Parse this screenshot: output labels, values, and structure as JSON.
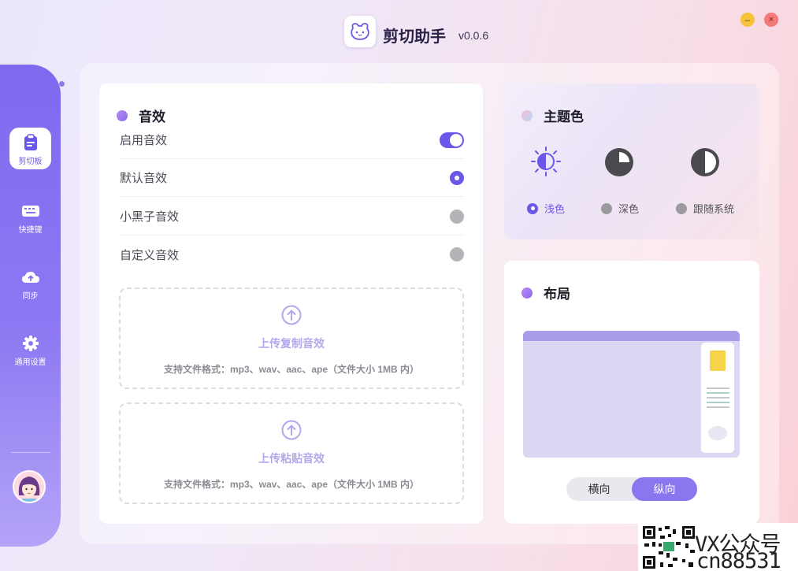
{
  "app": {
    "title": "剪切助手",
    "version": "v0.0.6",
    "minimize": "–",
    "close": "×"
  },
  "sidebar": {
    "items": [
      {
        "label": "剪切板",
        "icon": "clipboard-icon",
        "active": true
      },
      {
        "label": "快捷键",
        "icon": "keyboard-icon",
        "active": false
      },
      {
        "label": "同步",
        "icon": "cloud-upload-icon",
        "active": false
      },
      {
        "label": "通用设置",
        "icon": "gear-icon",
        "active": false
      }
    ]
  },
  "sound": {
    "title": "音效",
    "rows": [
      {
        "label": "启用音效",
        "control": "toggle",
        "on": true
      },
      {
        "label": "默认音效",
        "control": "radio",
        "on": true
      },
      {
        "label": "小黑子音效",
        "control": "radio",
        "on": false
      },
      {
        "label": "自定义音效",
        "control": "radio",
        "on": false
      }
    ],
    "uploads": [
      {
        "title": "上传复制音效",
        "hint": "支持文件格式：mp3、wav、aac、ape（文件大小 1MB 内）"
      },
      {
        "title": "上传粘贴音效",
        "hint": "支持文件格式：mp3、wav、aac、ape（文件大小 1MB 内）"
      }
    ]
  },
  "theme": {
    "title": "主题色",
    "options": [
      {
        "label": "浅色",
        "icon": "sun-icon",
        "selected": true
      },
      {
        "label": "深色",
        "icon": "moon-icon",
        "selected": false
      },
      {
        "label": "跟随系统",
        "icon": "half-circle-icon",
        "selected": false
      }
    ]
  },
  "layout": {
    "title": "布局",
    "segments": [
      {
        "label": "横向",
        "selected": false
      },
      {
        "label": "纵向",
        "selected": true
      }
    ]
  },
  "watermark": {
    "line1": "VX公众号",
    "line2": "cn88531"
  },
  "colors": {
    "accent": "#6a57e8",
    "sidebar": "#7e6af0",
    "upload_text": "#b1a8ec"
  }
}
